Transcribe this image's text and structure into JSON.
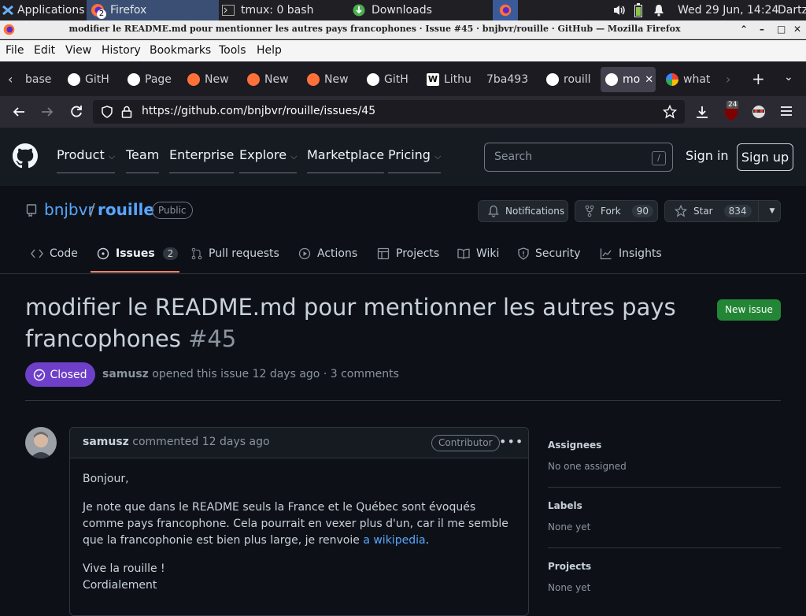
{
  "taskbar": {
    "applications": "Applications",
    "firefox_badge": "2",
    "firefox": "Firefox",
    "tmux": "tmux: 0 bash",
    "downloads": "Downloads",
    "clock": "Wed 29 Jun, 14:24",
    "user": "Dartz"
  },
  "window": {
    "title": "modifier le README.md pour mentionner les autres pays francophones · Issue #45 · bnjbvr/rouille · GitHub — Mozilla Firefox"
  },
  "menu": [
    "File",
    "Edit",
    "View",
    "History",
    "Bookmarks",
    "Tools",
    "Help"
  ],
  "tabs": [
    {
      "label": "base",
      "icon": "none"
    },
    {
      "label": "GitHub",
      "icon": "github"
    },
    {
      "label": "Page",
      "icon": "github"
    },
    {
      "label": "New",
      "icon": "firefox"
    },
    {
      "label": "New",
      "icon": "firefox"
    },
    {
      "label": "New",
      "icon": "firefox"
    },
    {
      "label": "GitHub",
      "icon": "github"
    },
    {
      "label": "Lithu",
      "icon": "wikipedia"
    },
    {
      "label": "7ba493",
      "icon": "none"
    },
    {
      "label": "rouille",
      "icon": "github"
    },
    {
      "label": "mo",
      "icon": "github"
    },
    {
      "label": "what",
      "icon": "google"
    }
  ],
  "toolbar": {
    "url": "https://github.com/bnjbvr/rouille/issues/45",
    "ublock_count": "24"
  },
  "github": {
    "nav": [
      "Product",
      "Team",
      "Enterprise",
      "Explore",
      "Marketplace",
      "Pricing"
    ],
    "search_placeholder": "Search",
    "search_key": "/",
    "sign_in": "Sign in",
    "sign_up": "Sign up"
  },
  "repo": {
    "owner": "bnjbvr",
    "sep": "/",
    "name": "rouille",
    "visibility": "Public",
    "notifications": "Notifications",
    "fork": "Fork",
    "fork_count": "90",
    "star": "Star",
    "star_count": "834",
    "tabs": {
      "code": "Code",
      "issues": "Issues",
      "issues_count": "2",
      "pulls": "Pull requests",
      "actions": "Actions",
      "projects": "Projects",
      "wiki": "Wiki",
      "security": "Security",
      "insights": "Insights"
    }
  },
  "issue": {
    "title": "modifier le README.md pour mentionner les autres pays francophones",
    "number": "#45",
    "new_issue": "New issue",
    "state": "Closed",
    "author": "samusz",
    "opened_text": "opened this issue 12 days ago · 3 comments"
  },
  "comment": {
    "author": "samusz",
    "when": "commented 12 days ago",
    "badge": "Contributor",
    "p1": "Bonjour,",
    "p2": "Je note que dans le README seuls la France et le Québec sont évoqués comme pays francophone. Cela pourrait en vexer plus d'un, car il me semble que la francophonie est bien plus large, je renvoie ",
    "p2_link": "a wikipedia",
    "p2_end": ".",
    "p3_line1": "Vive la rouille !",
    "p3_line2": "Cordialement"
  },
  "sidebar": {
    "assignees_h": "Assignees",
    "assignees_v": "No one assigned",
    "labels_h": "Labels",
    "labels_v": "None yet",
    "projects_h": "Projects",
    "projects_v": "None yet"
  },
  "colors": {
    "page_bg": "#0d1117",
    "closed_purple": "#6e40c9",
    "new_issue_green": "#238636",
    "link_blue": "#58a6ff",
    "issues_underline": "#f78166"
  }
}
